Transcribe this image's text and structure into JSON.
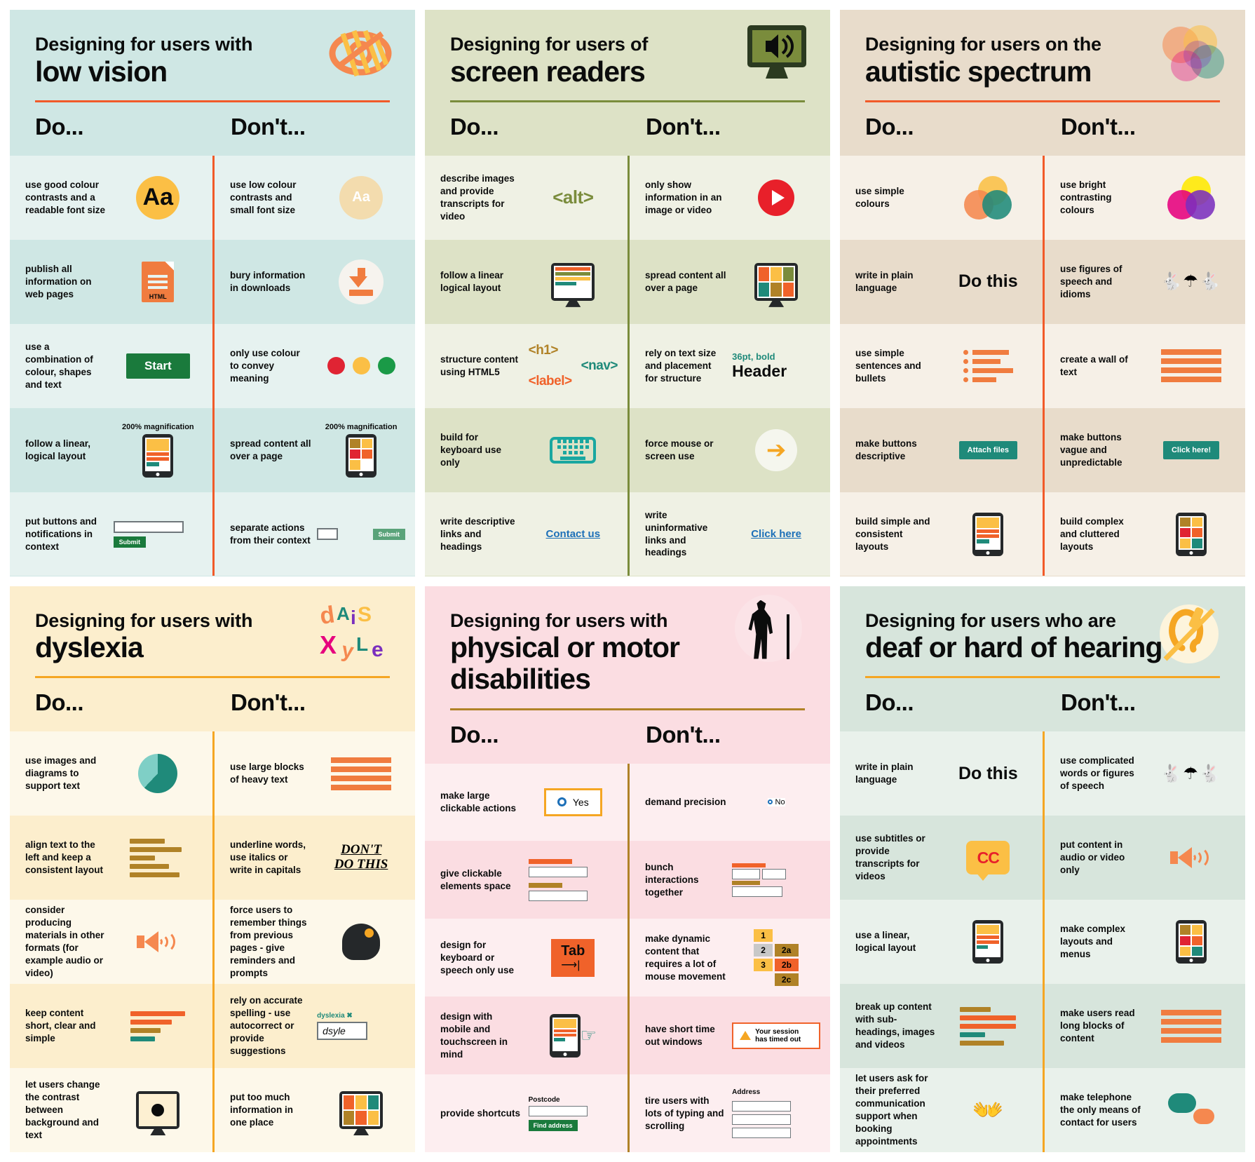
{
  "posters": [
    {
      "id": "low-vision",
      "title_line1": "Designing for users with",
      "title_line2": "low vision",
      "do_label": "Do...",
      "dont_label": "Don't...",
      "rows": [
        {
          "do": "use good colour contrasts and a readable font size",
          "dont": "use low colour contrasts and small font size",
          "do_art": {
            "type": "aa-big",
            "text": "Aa"
          },
          "dont_art": {
            "type": "aa-small",
            "text": "Aa"
          }
        },
        {
          "do": "publish all information on web pages",
          "dont": "bury information in downloads",
          "do_art": {
            "type": "html-doc",
            "text": "HTML"
          },
          "dont_art": {
            "type": "download"
          }
        },
        {
          "do": "use a combination of colour, shapes and text",
          "dont": "only use colour to convey meaning",
          "do_art": {
            "type": "button",
            "text": "Start"
          },
          "dont_art": {
            "type": "dots",
            "colors": [
              "#e02433",
              "#fbbf45",
              "#1a9a47"
            ]
          }
        },
        {
          "do": "follow a linear, logical layout",
          "dont": "spread content all over a page",
          "do_art": {
            "type": "tablet-linear",
            "caption": "200% magnification"
          },
          "dont_art": {
            "type": "tablet-scattered",
            "caption": "200% magnification"
          }
        },
        {
          "do": "put buttons and notifications in context",
          "dont": "separate actions from their context",
          "do_art": {
            "type": "form-inline",
            "button": "Submit"
          },
          "dont_art": {
            "type": "form-split",
            "button": "Submit"
          }
        }
      ]
    },
    {
      "id": "screen-readers",
      "title_line1": "Designing for users of",
      "title_line2": "screen readers",
      "do_label": "Do...",
      "dont_label": "Don't...",
      "rows": [
        {
          "do": "describe images and provide transcripts for video",
          "dont": "only show information in an image or video",
          "do_art": {
            "type": "code",
            "text": "<alt>",
            "color": "#7a8c3c"
          },
          "dont_art": {
            "type": "play"
          }
        },
        {
          "do": "follow a linear logical layout",
          "dont": "spread content all over a page",
          "do_art": {
            "type": "monitor-linear"
          },
          "dont_art": {
            "type": "monitor-scattered"
          }
        },
        {
          "do": "structure content using HTML5",
          "dont": "rely on text size and placement for structure",
          "do_art": {
            "type": "html5-tags",
            "tags": [
              {
                "text": "<h1>",
                "color": "#b08227"
              },
              {
                "text": "<nav>",
                "color": "#1f8a7a"
              },
              {
                "text": "<label>",
                "color": "#f0622a"
              }
            ]
          },
          "dont_art": {
            "type": "fake-header",
            "size_text": "36pt, bold",
            "header_text": "Header"
          }
        },
        {
          "do": "build for keyboard use only",
          "dont": "force mouse or screen use",
          "do_art": {
            "type": "keyboard"
          },
          "dont_art": {
            "type": "mouse-cursor"
          }
        },
        {
          "do": "write descriptive links and headings",
          "dont": "write uninformative links and headings",
          "do_art": {
            "type": "link",
            "text": "Contact us"
          },
          "dont_art": {
            "type": "link",
            "text": "Click here"
          }
        }
      ]
    },
    {
      "id": "autistic-spectrum",
      "title_line1": "Designing for users on the",
      "title_line2": "autistic spectrum",
      "do_label": "Do...",
      "dont_label": "Don't...",
      "rows": [
        {
          "do": "use simple colours",
          "dont": "use bright contrasting colours",
          "do_art": {
            "type": "venn",
            "colors": [
              "#fbbf45",
              "#f5884f",
              "#1f8a7a"
            ]
          },
          "dont_art": {
            "type": "venn",
            "colors": [
              "#ffe800",
              "#e6007e",
              "#7b2fbe"
            ]
          }
        },
        {
          "do": "write in plain language",
          "dont": "use figures of speech and idioms",
          "do_art": {
            "type": "do-this",
            "text": "Do this"
          },
          "dont_art": {
            "type": "idioms"
          }
        },
        {
          "do": "use simple sentences and bullets",
          "dont": "create a wall of text",
          "do_art": {
            "type": "bullets"
          },
          "dont_art": {
            "type": "wall-of-text"
          }
        },
        {
          "do": "make buttons descriptive",
          "dont": "make buttons vague and unpredictable",
          "do_art": {
            "type": "teal-button",
            "text": "Attach files"
          },
          "dont_art": {
            "type": "teal-button",
            "text": "Click here!"
          }
        },
        {
          "do": "build simple and consistent layouts",
          "dont": "build complex and cluttered layouts",
          "do_art": {
            "type": "tablet-linear"
          },
          "dont_art": {
            "type": "tablet-scattered"
          }
        }
      ]
    },
    {
      "id": "dyslexia",
      "title_line1": "Designing for users with",
      "title_line2": "dyslexia",
      "do_label": "Do...",
      "dont_label": "Don't...",
      "rows": [
        {
          "do": "use images and diagrams to support text",
          "dont": "use large blocks of heavy text",
          "do_art": {
            "type": "pie"
          },
          "dont_art": {
            "type": "wall-of-text"
          }
        },
        {
          "do": "align text to the left and keep a consistent layout",
          "dont": "underline words, use italics or write in capitals",
          "do_art": {
            "type": "aligned-bars"
          },
          "dont_art": {
            "type": "dont-do-this",
            "line1": "DON'T",
            "line2": "DO THIS"
          }
        },
        {
          "do": "consider producing materials in other formats (for example audio or video)",
          "dont": "force users to remember things from previous pages - give reminders and prompts",
          "do_art": {
            "type": "speaker"
          },
          "dont_art": {
            "type": "head-gear"
          }
        },
        {
          "do": "keep content short, clear and simple",
          "dont": "rely on accurate spelling - use autocorrect or provide suggestions",
          "do_art": {
            "type": "short-bars"
          },
          "dont_art": {
            "type": "spellcheck",
            "hint": "dyslexia",
            "value": "dsyle"
          }
        },
        {
          "do": "let users change the contrast between background and text",
          "dont": "put too much information in one place",
          "do_art": {
            "type": "contrast-monitor"
          },
          "dont_art": {
            "type": "monitor-scattered"
          }
        }
      ]
    },
    {
      "id": "physical-motor",
      "title_line1": "Designing for users with",
      "title_line2": "physical or motor disabilities",
      "do_label": "Do...",
      "dont_label": "Don't...",
      "rows": [
        {
          "do": "make large clickable actions",
          "dont": "demand precision",
          "do_art": {
            "type": "radio-large",
            "text": "Yes"
          },
          "dont_art": {
            "type": "radio-small",
            "text": "No"
          }
        },
        {
          "do": "give clickable elements space",
          "dont": "bunch interactions together",
          "do_art": {
            "type": "spaced-fields"
          },
          "dont_art": {
            "type": "bunched-fields"
          }
        },
        {
          "do": "design for keyboard or speech only use",
          "dont": "make dynamic content that requires a lot of mouse movement",
          "do_art": {
            "type": "tab-key",
            "text": "Tab"
          },
          "dont_art": {
            "type": "menu-steps",
            "items": [
              "1",
              "2",
              "3",
              "2a",
              "2b",
              "2c"
            ]
          }
        },
        {
          "do": "design with mobile and touchscreen in mind",
          "dont": "have short time out windows",
          "do_art": {
            "type": "touch-tablet"
          },
          "dont_art": {
            "type": "timeout-warning",
            "text": "Your session has timed out"
          }
        },
        {
          "do": "provide shortcuts",
          "dont": "tire users with lots of typing and scrolling",
          "do_art": {
            "type": "postcode-lookup",
            "label": "Postcode",
            "button": "Find address"
          },
          "dont_art": {
            "type": "address-fields",
            "label": "Address"
          }
        }
      ]
    },
    {
      "id": "deaf-hard-of-hearing",
      "title_line1": "Designing for users who are",
      "title_line2": "deaf or hard of hearing",
      "do_label": "Do...",
      "dont_label": "Don't...",
      "rows": [
        {
          "do": "write in plain language",
          "dont": "use complicated words or figures of speech",
          "do_art": {
            "type": "do-this",
            "text": "Do this"
          },
          "dont_art": {
            "type": "idioms"
          }
        },
        {
          "do": "use subtitles or provide transcripts for videos",
          "dont": "put content in audio or video only",
          "do_art": {
            "type": "cc-bubble",
            "text": "CC"
          },
          "dont_art": {
            "type": "speaker"
          }
        },
        {
          "do": "use a linear, logical layout",
          "dont": "make complex layouts and menus",
          "do_art": {
            "type": "tablet-linear"
          },
          "dont_art": {
            "type": "tablet-scattered"
          }
        },
        {
          "do": "break up content with sub-headings, images and videos",
          "dont": "make users read long blocks of content",
          "do_art": {
            "type": "mixed-bars"
          },
          "dont_art": {
            "type": "wall-of-text"
          }
        },
        {
          "do": "let users ask for their preferred communication support when booking appointments",
          "dont": "make telephone the only means of contact for users",
          "do_art": {
            "type": "hands"
          },
          "dont_art": {
            "type": "speech-bubbles"
          }
        }
      ]
    }
  ]
}
